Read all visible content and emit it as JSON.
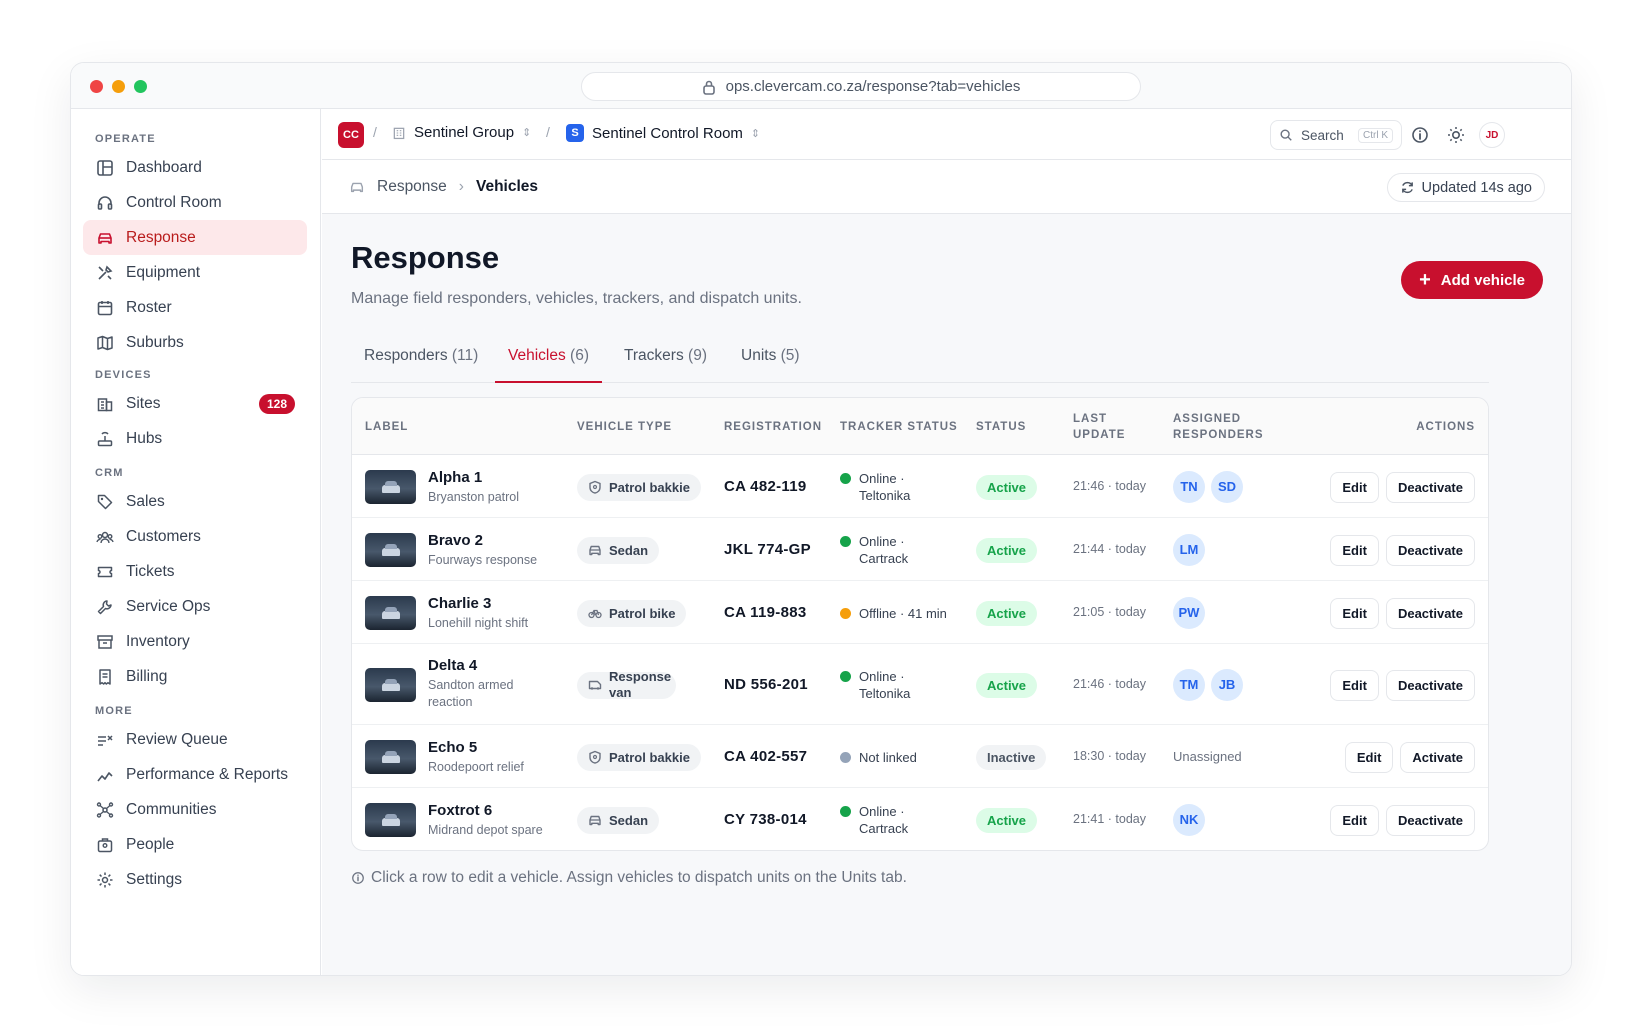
{
  "browser": {
    "url": "ops.clevercam.co.za/response?tab=vehicles"
  },
  "sidebar": {
    "sections": [
      {
        "title": "OPERATE",
        "items": [
          {
            "label": "Dashboard",
            "icon": "dashboard-icon"
          },
          {
            "label": "Control Room",
            "icon": "headset-icon"
          },
          {
            "label": "Response",
            "icon": "car-icon",
            "active": true
          },
          {
            "label": "Equipment",
            "icon": "tools-icon"
          },
          {
            "label": "Roster",
            "icon": "calendar-icon"
          },
          {
            "label": "Suburbs",
            "icon": "map-icon"
          }
        ]
      },
      {
        "title": "DEVICES",
        "items": [
          {
            "label": "Sites",
            "icon": "building-icon",
            "badge": "128"
          },
          {
            "label": "Hubs",
            "icon": "router-icon"
          }
        ]
      },
      {
        "title": "CRM",
        "items": [
          {
            "label": "Sales",
            "icon": "tag-icon"
          },
          {
            "label": "Customers",
            "icon": "users-icon"
          },
          {
            "label": "Tickets",
            "icon": "ticket-icon"
          },
          {
            "label": "Service Ops",
            "icon": "wrench-icon"
          },
          {
            "label": "Inventory",
            "icon": "archive-icon"
          },
          {
            "label": "Billing",
            "icon": "receipt-icon"
          }
        ]
      },
      {
        "title": "MORE",
        "items": [
          {
            "label": "Review Queue",
            "icon": "list-check-icon"
          },
          {
            "label": "Performance & Reports",
            "icon": "chart-icon"
          },
          {
            "label": "Communities",
            "icon": "network-icon"
          },
          {
            "label": "People",
            "icon": "people-icon"
          },
          {
            "label": "Settings",
            "icon": "gear-icon"
          }
        ]
      }
    ]
  },
  "topbar": {
    "org_badge": "CC",
    "group": "Sentinel Group",
    "room_badge": "S",
    "room": "Sentinel Control Room",
    "search_label": "Search",
    "search_shortcut": "Ctrl K",
    "user_initials": "JD"
  },
  "breadcrumb": {
    "parent": "Response",
    "current": "Vehicles",
    "updated": "Updated 14s ago"
  },
  "page": {
    "title": "Response",
    "subtitle": "Manage field responders, vehicles, trackers, and dispatch units.",
    "add_button": "Add vehicle"
  },
  "tabs": [
    {
      "label": "Responders",
      "count": "(11)"
    },
    {
      "label": "Vehicles",
      "count": "(6)",
      "active": true
    },
    {
      "label": "Trackers",
      "count": "(9)"
    },
    {
      "label": "Units",
      "count": "(5)"
    }
  ],
  "table": {
    "headers": {
      "label": "LABEL",
      "vehicle_type": "VEHICLE TYPE",
      "registration": "REGISTRATION",
      "tracker_status": "TRACKER STATUS",
      "status": "STATUS",
      "last_update_1": "LAST",
      "last_update_2": "UPDATE",
      "assigned_1": "ASSIGNED",
      "assigned_2": "RESPONDERS",
      "actions": "ACTIONS"
    },
    "rows": [
      {
        "name": "Alpha 1",
        "desc": "Bryanston patrol",
        "type": "Patrol bakkie",
        "type_icon": "shield-icon",
        "reg": "CA 482-119",
        "tracker_1": "Online ·",
        "tracker_2": "Teltonika",
        "tracker_color": "#16a34a",
        "status": "Active",
        "updated": "21:46 · today",
        "responders": [
          "TN",
          "SD"
        ],
        "edit": "Edit",
        "toggle": "Deactivate"
      },
      {
        "name": "Bravo 2",
        "desc": "Fourways response",
        "type": "Sedan",
        "type_icon": "car-icon",
        "reg": "JKL 774-GP",
        "tracker_1": "Online ·",
        "tracker_2": "Cartrack",
        "tracker_color": "#16a34a",
        "status": "Active",
        "updated": "21:44 · today",
        "responders": [
          "LM"
        ],
        "edit": "Edit",
        "toggle": "Deactivate"
      },
      {
        "name": "Charlie 3",
        "desc": "Lonehill night shift",
        "type": "Patrol bike",
        "type_icon": "bike-icon",
        "reg": "CA 119-883",
        "tracker_1": "Offline · 41 min",
        "tracker_2": "",
        "tracker_color": "#f59e0b",
        "status": "Active",
        "updated": "21:05 · today",
        "responders": [
          "PW"
        ],
        "edit": "Edit",
        "toggle": "Deactivate"
      },
      {
        "name": "Delta 4",
        "desc": "Sandton armed reaction",
        "type": "Response van",
        "type_icon": "van-icon",
        "reg": "ND 556-201",
        "tracker_1": "Online ·",
        "tracker_2": "Teltonika",
        "tracker_color": "#16a34a",
        "status": "Active",
        "updated": "21:46 · today",
        "responders": [
          "TM",
          "JB"
        ],
        "edit": "Edit",
        "toggle": "Deactivate"
      },
      {
        "name": "Echo 5",
        "desc": "Roodepoort relief",
        "type": "Patrol bakkie",
        "type_icon": "shield-icon",
        "reg": "CA 402-557",
        "tracker_1": "Not linked",
        "tracker_2": "",
        "tracker_color": "#94a3b8",
        "status": "Inactive",
        "updated": "18:30 · today",
        "responders": [],
        "unassigned": "Unassigned",
        "edit": "Edit",
        "toggle": "Activate"
      },
      {
        "name": "Foxtrot 6",
        "desc": "Midrand depot spare",
        "type": "Sedan",
        "type_icon": "car-icon",
        "reg": "CY 738-014",
        "tracker_1": "Online ·",
        "tracker_2": "Cartrack",
        "tracker_color": "#16a34a",
        "status": "Active",
        "updated": "21:41 · today",
        "responders": [
          "NK"
        ],
        "edit": "Edit",
        "toggle": "Deactivate"
      }
    ]
  },
  "footnote": "Click a row to edit a vehicle. Assign vehicles to dispatch units on the Units tab.",
  "colors": {
    "brand": "#c8102e",
    "active_bg": "#fde8ea",
    "success": "#16a34a",
    "warning": "#f59e0b"
  }
}
